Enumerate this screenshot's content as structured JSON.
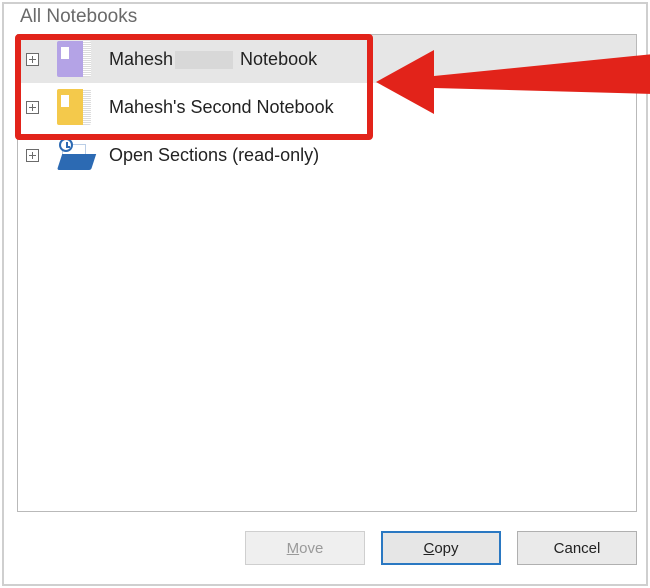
{
  "header": {
    "label": "All Notebooks"
  },
  "tree": {
    "items": [
      {
        "label_prefix": "Mahesh",
        "label_suffix": " Notebook",
        "redacted_middle": true
      },
      {
        "label": "Mahesh's Second Notebook"
      },
      {
        "label": "Open Sections (read-only)"
      }
    ]
  },
  "buttons": {
    "move": {
      "label": "Move",
      "first": "M",
      "rest": "ove"
    },
    "copy": {
      "label": "Copy",
      "first": "C",
      "rest": "opy"
    },
    "cancel": {
      "label": "Cancel"
    }
  }
}
